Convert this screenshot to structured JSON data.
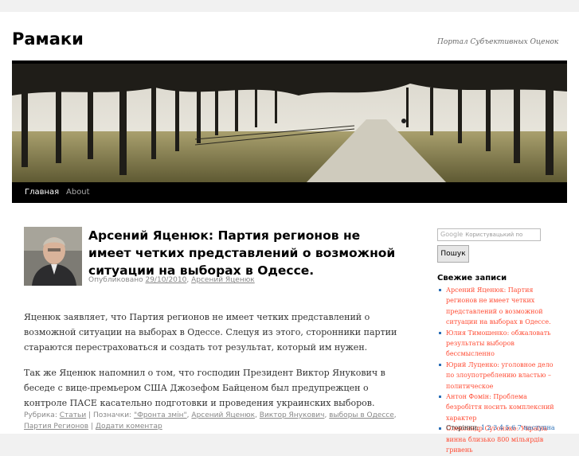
{
  "site": {
    "title": "Рамаки",
    "description": "Портал Субъективных Оценок"
  },
  "nav": {
    "items": [
      {
        "label": "Главная",
        "current": true
      },
      {
        "label": "About",
        "current": false
      }
    ]
  },
  "post": {
    "title": "Арсений Яценюк: Партия регионов не имеет четких представлений о возможной ситуации на выборах в Одессе.",
    "meta": {
      "published_label": "Опубликовано",
      "date": "29/10/2010",
      "separator": ",",
      "author": "Арсений Яценюк"
    },
    "paragraphs": [
      "Яценюк заявляет, что Партия регионов не имеет четких представлений о возможной ситуации на выборах в Одессе. Слецуя из этого, сторонники партии стараются перестраховаться и создать тот результат, который им нужен.",
      "Так же Яценюк напомнил о том, что господин Президент  Виктор Янукович в беседе с вице-премьером США   Джозефом Байценом был предупрежцен  о контроле ПАСЕ касательно подготовки и проведения украинских  выборов."
    ],
    "utility": {
      "category_label": "Рубрика:",
      "category": "Статьи",
      "sep1": "|",
      "tags_label": "Позначки:",
      "tags": [
        "\"Фронта змін\"",
        "Арсений Яценюк",
        "Виктор Янукович",
        "выборы в Одессе",
        "Партия Регионов"
      ],
      "sep2": "|",
      "comment_link": "Додати коментар"
    }
  },
  "sidebar": {
    "search": {
      "logo_text": "Google",
      "placeholder": "Користувацький по",
      "button_label": "Пошук"
    },
    "recent": {
      "title": "Свежие записи",
      "items": [
        "Арсений Яценюк: Партия регионов не имеет четких представлений о возможной ситуации на выборах в Одессе.",
        "Юлия Тимошенко: обжаловать результаты выборов бессмысленно",
        "Юрий Луценко: уголовное дело по злоупотреблению властью – политическое",
        "Антон Фомін: Проблема безробіття носить комплексний характер",
        "Олександр Сугоняко: Україна винна близько 800 мільярдів гривень"
      ]
    },
    "pages": {
      "label": "Сторінки:",
      "numbers": [
        "1",
        "2",
        "3",
        "4",
        "5",
        "6",
        "7"
      ],
      "next_label": "наступна"
    }
  },
  "colors": {
    "accent_link": "#ff4b33",
    "nav_bg": "#000000",
    "page_bg": "#f1f1f1"
  }
}
